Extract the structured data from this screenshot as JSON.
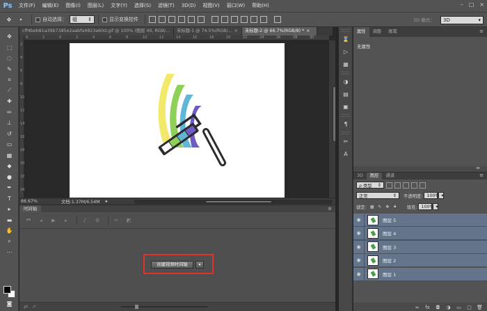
{
  "app": {
    "logo": "Ps"
  },
  "menu": [
    "文件(F)",
    "编辑(E)",
    "图像(I)",
    "图层(L)",
    "文字(Y)",
    "选择(S)",
    "滤镜(T)",
    "3D(D)",
    "视图(V)",
    "窗口(W)",
    "帮助(H)"
  ],
  "window_controls": {
    "minimize": "–",
    "maximize": "□",
    "close": "×"
  },
  "options": {
    "auto_select_label": "自动选择：",
    "auto_select_value": "组",
    "show_transform_label": "显示变换控件",
    "mode_3d_label": "3D 模式：",
    "workspace": "3D"
  },
  "tabs": [
    {
      "label": "cff4beb81a39b7385e2aabfa4823a60d.gif @ 100% (图层 40, RGB/...",
      "close": "×"
    },
    {
      "label": "未标题-1 @ 74.5%(RGB/...",
      "close": "×"
    },
    {
      "label": "未标题-2 @ 66.7%(RGB/8) *",
      "close": "×"
    }
  ],
  "ruler": {
    "h": [
      "4",
      "2",
      "0",
      "2",
      "4",
      "6",
      "8",
      "10",
      "12",
      "14",
      "16",
      "18",
      "20",
      "22",
      "24",
      "26",
      "28",
      "30"
    ],
    "v": [
      "2",
      "4",
      "6",
      "8",
      "10",
      "12",
      "14",
      "16",
      "18",
      "20",
      "22",
      "24"
    ]
  },
  "status": {
    "zoom": "66.67%",
    "doc": "文档:1.37M/6.54M",
    "arrow": "▸"
  },
  "timeline": {
    "tab": "时间轴",
    "menu": "≡",
    "create_button": "创建视频时间轴",
    "dropdown_arrow": "▾"
  },
  "properties": {
    "tabs": [
      "属性",
      "调整",
      "画笔"
    ],
    "empty_text": "无属性",
    "menu": "≡"
  },
  "layers_panel": {
    "tabs": [
      "3D",
      "图层",
      "通道"
    ],
    "menu": "≡",
    "filter_type": "ρ 类型",
    "blend_mode": "正常",
    "opacity_label": "不透明度:",
    "opacity_value": "100%",
    "lock_label": "锁定:",
    "fill_label": "填充:",
    "fill_value": "100%",
    "layers": [
      "图层 5",
      "图层 4",
      "图层 3",
      "图层 2",
      "图层 1"
    ],
    "eye_glyph": "◉"
  },
  "colors": {
    "selection_highlight": "#e0342b",
    "layer_row": "#64748a",
    "rainbow": [
      "#f2e96a",
      "#8fd05a",
      "#5fb6d6",
      "#6f5cc3"
    ]
  }
}
